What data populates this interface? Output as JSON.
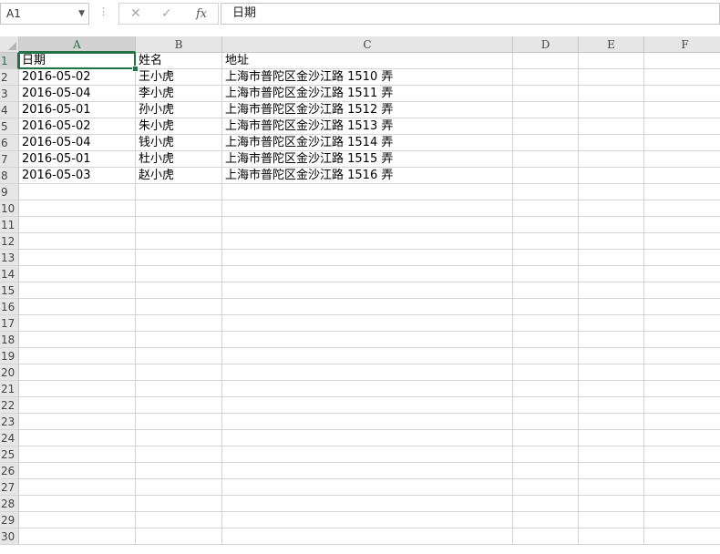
{
  "name_box": "A1",
  "formula_bar": {
    "cancel_icon": "✕",
    "confirm_icon": "✓",
    "function_label": "fx",
    "content": "日期"
  },
  "columns": [
    "A",
    "B",
    "C",
    "D",
    "E",
    "F"
  ],
  "row_count": 30,
  "rows": [
    [
      "日期",
      "姓名",
      "地址"
    ],
    [
      "2016-05-02",
      "王小虎",
      "上海市普陀区金沙江路 1510 弄"
    ],
    [
      "2016-05-04",
      "李小虎",
      "上海市普陀区金沙江路 1511 弄"
    ],
    [
      "2016-05-01",
      "孙小虎",
      "上海市普陀区金沙江路 1512 弄"
    ],
    [
      "2016-05-02",
      "朱小虎",
      "上海市普陀区金沙江路 1513 弄"
    ],
    [
      "2016-05-04",
      "钱小虎",
      "上海市普陀区金沙江路 1514 弄"
    ],
    [
      "2016-05-01",
      "杜小虎",
      "上海市普陀区金沙江路 1515 弄"
    ],
    [
      "2016-05-03",
      "赵小虎",
      "上海市普陀区金沙江路 1516 弄"
    ]
  ],
  "colors": {
    "accent": "#217346",
    "header_bg": "#e6e6e6",
    "gridline": "#d4d4d4"
  }
}
